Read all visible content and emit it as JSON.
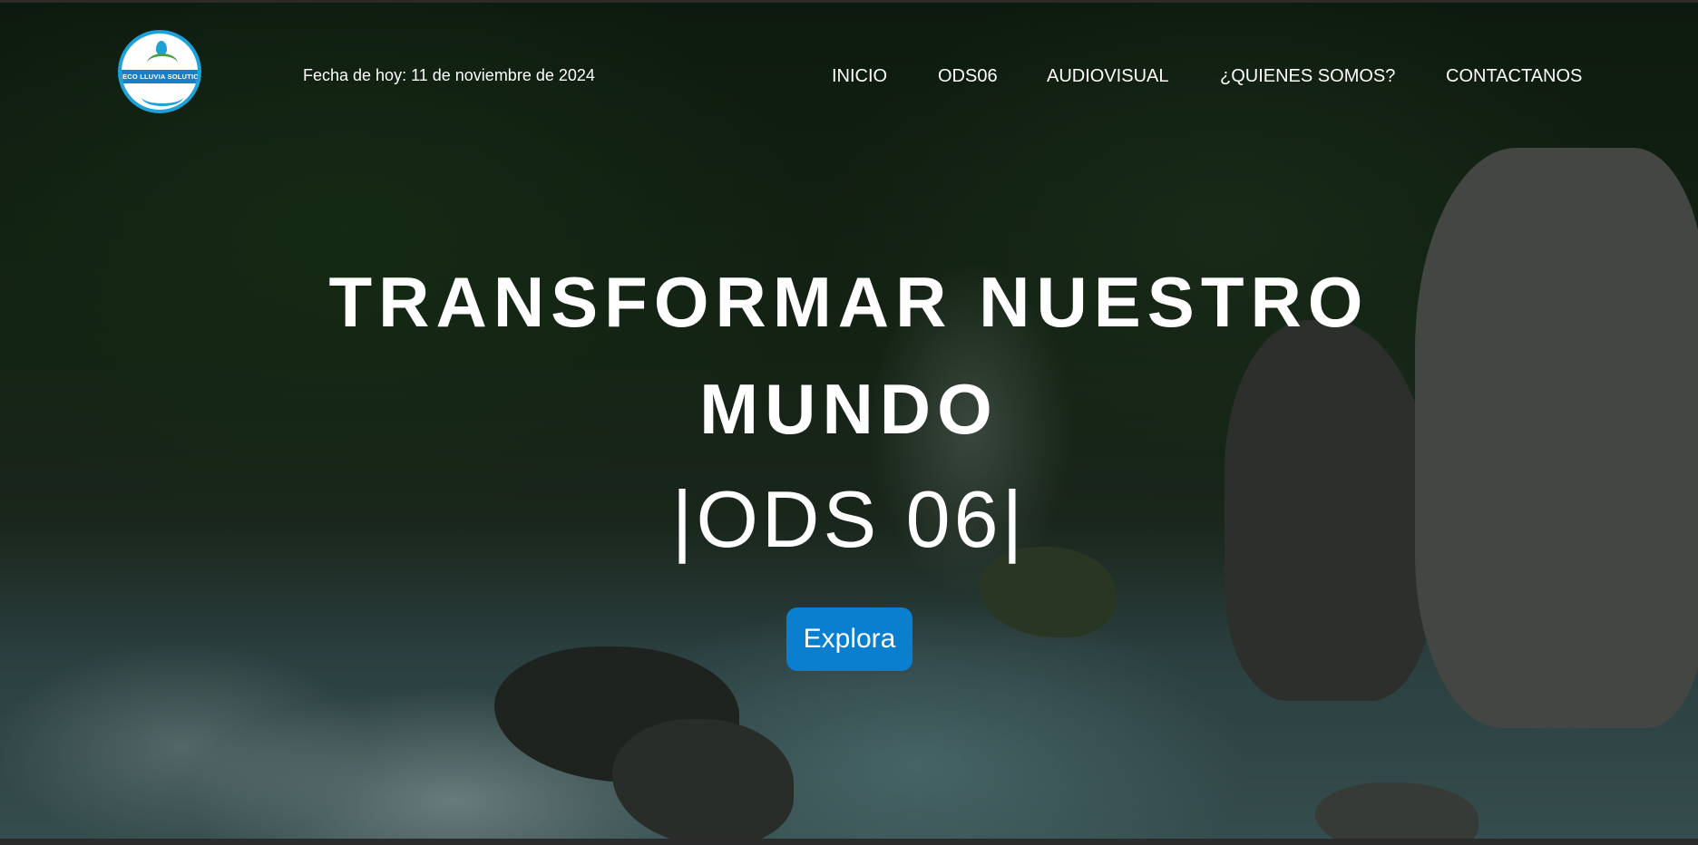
{
  "header": {
    "logo_text": "ECO LLUVIA SOLUTION",
    "date_text": "Fecha de hoy: 11 de noviembre de 2024"
  },
  "nav": {
    "items": [
      {
        "label": "INICIO"
      },
      {
        "label": "ODS06"
      },
      {
        "label": "AUDIOVISUAL"
      },
      {
        "label": "¿QUIENES SOMOS?"
      },
      {
        "label": "CONTACTANOS"
      }
    ]
  },
  "hero": {
    "title_line1": "TRANSFORMAR NUESTRO",
    "title_line2": "MUNDO",
    "subtitle": "|ODS 06|",
    "cta_label": "Explora"
  },
  "colors": {
    "accent": "#0a7fd0",
    "text": "#ffffff",
    "logo_blue": "#1ea0d8"
  }
}
